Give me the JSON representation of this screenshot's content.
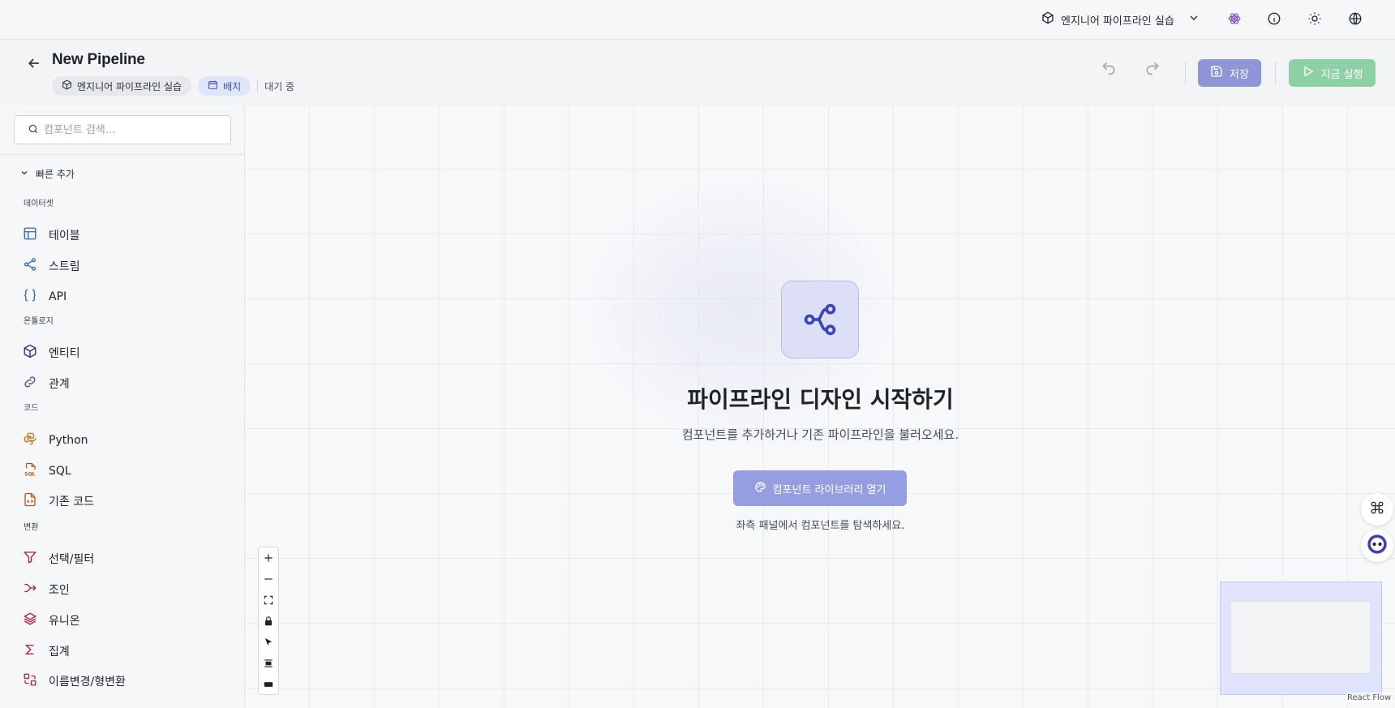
{
  "topbar": {
    "workspace_name": "엔지니어 파이프라인 실습",
    "icons": [
      "cube-icon",
      "chevron-down-icon",
      "atom-icon",
      "info-icon",
      "sun-icon",
      "globe-icon"
    ]
  },
  "header": {
    "title": "New Pipeline",
    "workspace_chip": "엔지니어 파이프라인 실습",
    "mode_chip": "배치",
    "status": "대기 중",
    "save_label": "저장",
    "run_label": "지금 실행"
  },
  "sidebar": {
    "search_placeholder": "컴포넌트 검색...",
    "quick_add_label": "빠른 추가",
    "groups": [
      {
        "label": "데이터셋",
        "items": [
          {
            "label": "테이블",
            "icon": "table-icon"
          },
          {
            "label": "스트림",
            "icon": "share-icon"
          },
          {
            "label": "API",
            "icon": "braces-icon"
          }
        ]
      },
      {
        "label": "온톨로지",
        "items": [
          {
            "label": "엔티티",
            "icon": "cube-icon"
          },
          {
            "label": "관계",
            "icon": "link-icon"
          }
        ]
      },
      {
        "label": "코드",
        "items": [
          {
            "label": "Python",
            "icon": "python-icon"
          },
          {
            "label": "SQL",
            "icon": "sql-file-icon"
          },
          {
            "label": "기존 코드",
            "icon": "code-file-icon"
          }
        ]
      },
      {
        "label": "변환",
        "items": [
          {
            "label": "선택/필터",
            "icon": "filter-icon"
          },
          {
            "label": "조인",
            "icon": "merge-icon"
          },
          {
            "label": "유니온",
            "icon": "layers-icon"
          },
          {
            "label": "집계",
            "icon": "sigma-icon"
          },
          {
            "label": "이름변경/형변환",
            "icon": "swap-icon"
          }
        ]
      }
    ]
  },
  "canvas": {
    "empty_title": "파이프라인 디자인 시작하기",
    "empty_subtitle": "컴포넌트를 추가하거나 기존 파이프라인을 불러오세요.",
    "library_button": "컴포넌트 라이브러리 열기",
    "hint": "좌측 패널에서 컴포넌트를 탐색하세요.",
    "attribution": "React Flow"
  },
  "colors": {
    "accent": "#3b55c9",
    "save_button": "#8e96d8",
    "run_button": "#8ed0a6",
    "library_button": "#959ee0"
  }
}
